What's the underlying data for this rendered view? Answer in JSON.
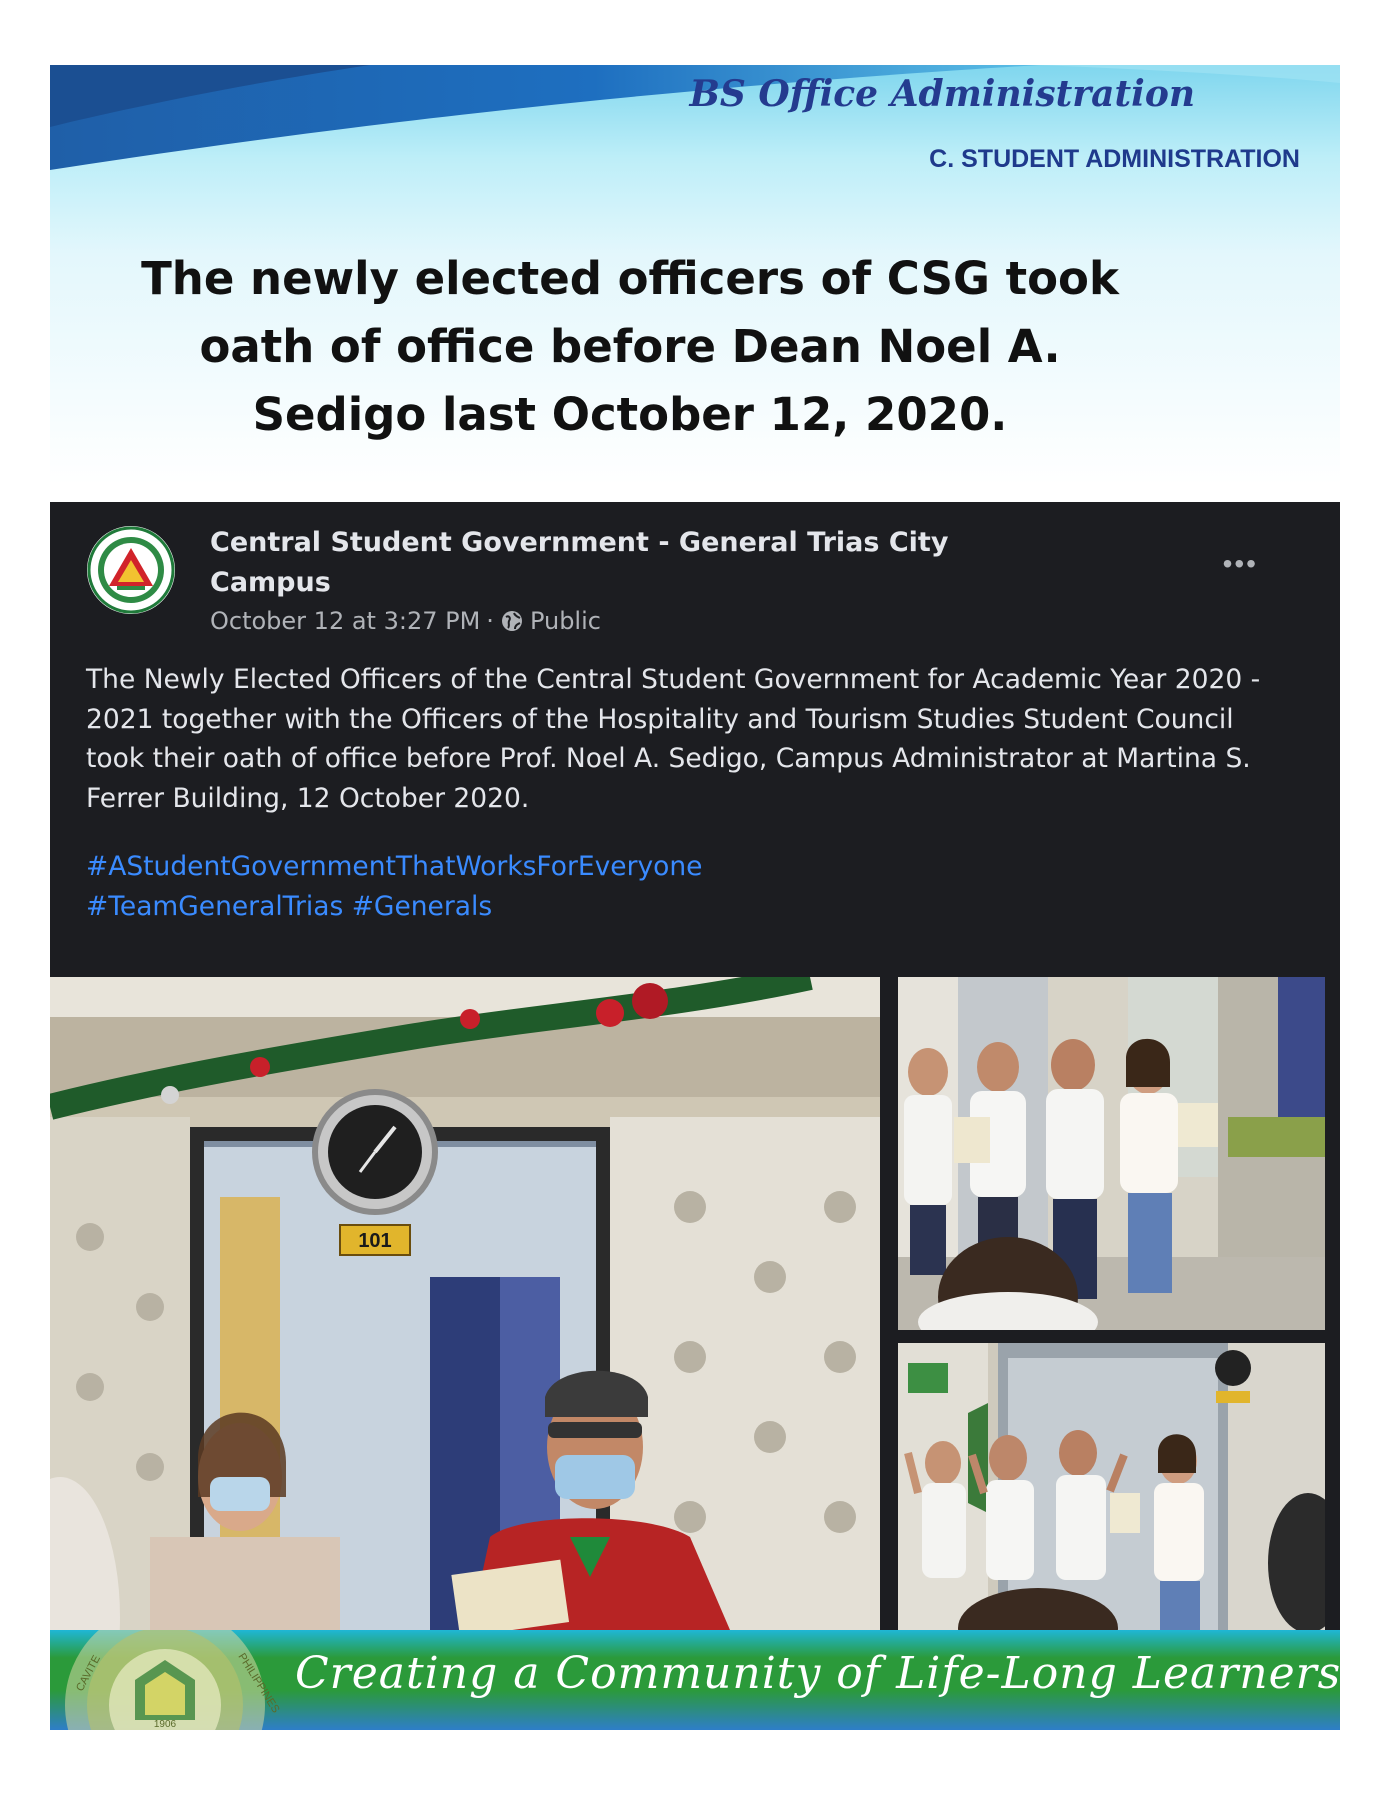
{
  "header": {
    "program_title": "BS Office Administration",
    "section_label": "C. STUDENT ADMINISTRATION",
    "headline": "The newly elected officers of CSG took oath of office before Dean Noel A. Sedigo last October 12, 2020.",
    "accent_color": "#1f3a8c"
  },
  "post": {
    "author": "Central Student Government - General Trias City Campus",
    "date": "October 12 at 3:27 PM",
    "separator": "·",
    "audience": "Public",
    "text": "The Newly Elected Officers of the Central Student Government for Academic Year 2020 - 2021 together with the Officers of the Hospitality and Tourism Studies Student Council took their oath of office before Prof. Noel A. Sedigo, Campus Administrator at Martina S. Ferrer Building, 12 October 2020.",
    "hashtags": [
      "#AStudentGovernmentThatWorksForEveryone",
      "#TeamGeneralTrias",
      "#Generals"
    ],
    "more_icon": "more-options-icon",
    "audience_icon": "globe-icon",
    "room_number": "101",
    "hashtag_color": "#3a8bff"
  },
  "footer": {
    "tagline": "Creating a Community of Life-Long Learners",
    "seal_left_text": "CAVITE",
    "seal_right_text": "PHILIPPINES",
    "seal_year": "1906"
  }
}
